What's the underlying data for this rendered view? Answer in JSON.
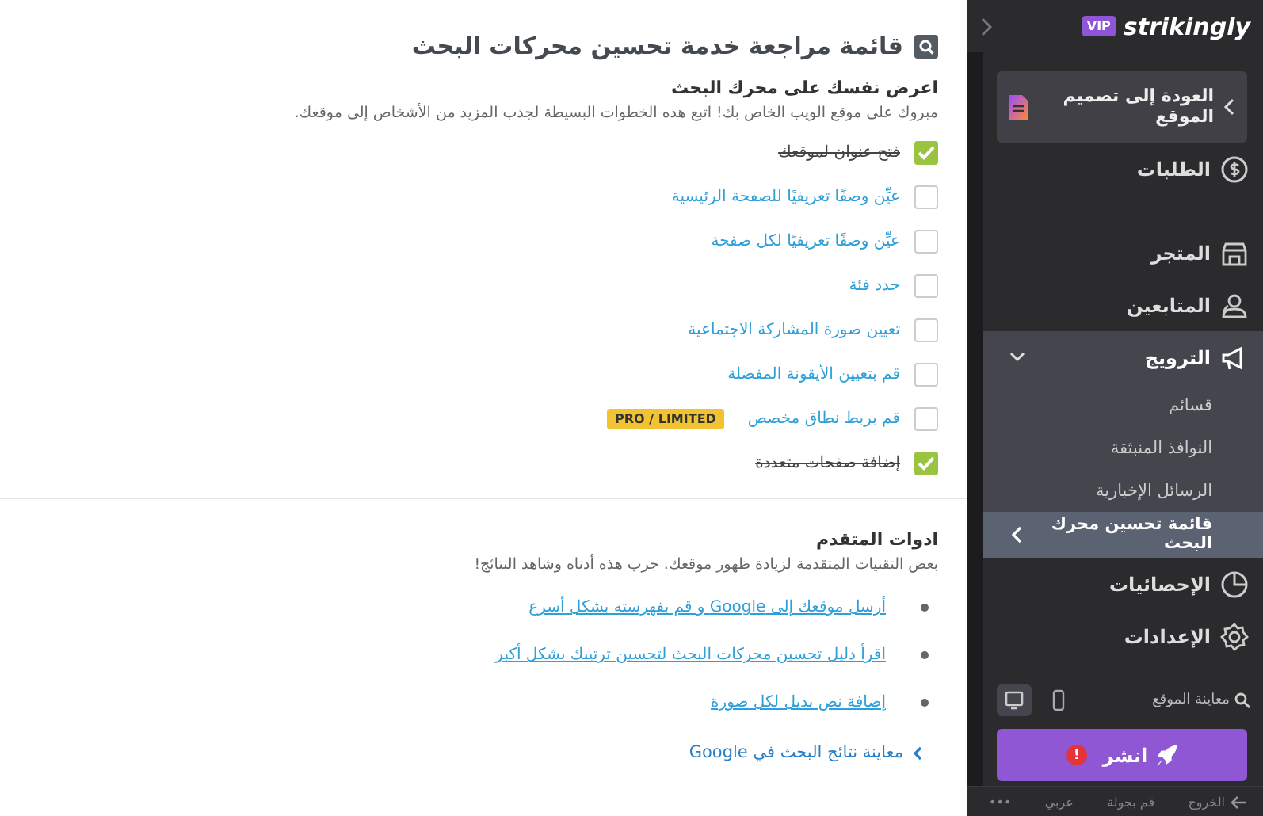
{
  "main": {
    "title": "قائمة مراجعة خدمة تحسين محركات البحث",
    "checklist": {
      "heading": "اعرض نفسك على محرك البحث",
      "subtitle": "مبروك على موقع الويب الخاص بك! اتبع هذه الخطوات البسيطة لجذب المزيد من الأشخاص إلى موقعك.",
      "items": [
        {
          "label": "فتح عنوان لموقعك",
          "checked": true
        },
        {
          "label": "عيِّن وصفًا تعريفيًا للصفحة الرئيسية",
          "checked": false
        },
        {
          "label": "عيِّن وصفًا تعريفيًا لكل صفحة",
          "checked": false
        },
        {
          "label": "حدد فئة",
          "checked": false
        },
        {
          "label": "تعيين صورة المشاركة الاجتماعية",
          "checked": false
        },
        {
          "label": "قم بتعيين الأيقونة المفضلة",
          "checked": false
        },
        {
          "label": "قم بربط نطاق مخصص",
          "checked": false,
          "badge": "PRO / LIMITED"
        },
        {
          "label": "إضافة صفحات متعددة",
          "checked": true
        }
      ]
    },
    "advanced": {
      "heading": "ادوات المتقدم",
      "subtitle": "بعض التقنيات المتقدمة لزيادة ظهور موقعك. جرب هذه أدناه وشاهد النتائج!",
      "links": [
        "أرسل موقعك إلى Google و قم بفهرسته بشكل أسرع",
        "اقرأ دليل تحسين محركات البحث لتحسين ترتيبك بشكل أكبر",
        "إضافة نص بديل لكل صورة"
      ],
      "preview_link": "معاينة نتائج البحث في Google"
    }
  },
  "sidebar": {
    "logo": "strikingly",
    "badge": "VIP",
    "back": "العودة إلى تصميم الموقع",
    "nav": [
      {
        "label": "الطلبات"
      },
      {
        "label": "المتجر"
      },
      {
        "label": "المتابعين"
      },
      {
        "label": "الترويج",
        "expanded": true,
        "children": [
          {
            "label": "قسائم",
            "selected": false
          },
          {
            "label": "النوافذ المنبثقة",
            "selected": false
          },
          {
            "label": "الرسائل الإخبارية",
            "selected": false
          },
          {
            "label": "قائمة تحسين محرك البحث",
            "selected": true
          }
        ]
      },
      {
        "label": "الإحصائيات"
      },
      {
        "label": "الإعدادات"
      }
    ],
    "preview": {
      "label": "معاينة الموقع",
      "devices": [
        {
          "selected": true
        },
        {
          "selected": false
        }
      ]
    },
    "publish": {
      "label": "انشر",
      "alert": "!"
    },
    "footer": [
      "الخروج",
      "قم بجولة",
      "عربي",
      "•••"
    ]
  }
}
